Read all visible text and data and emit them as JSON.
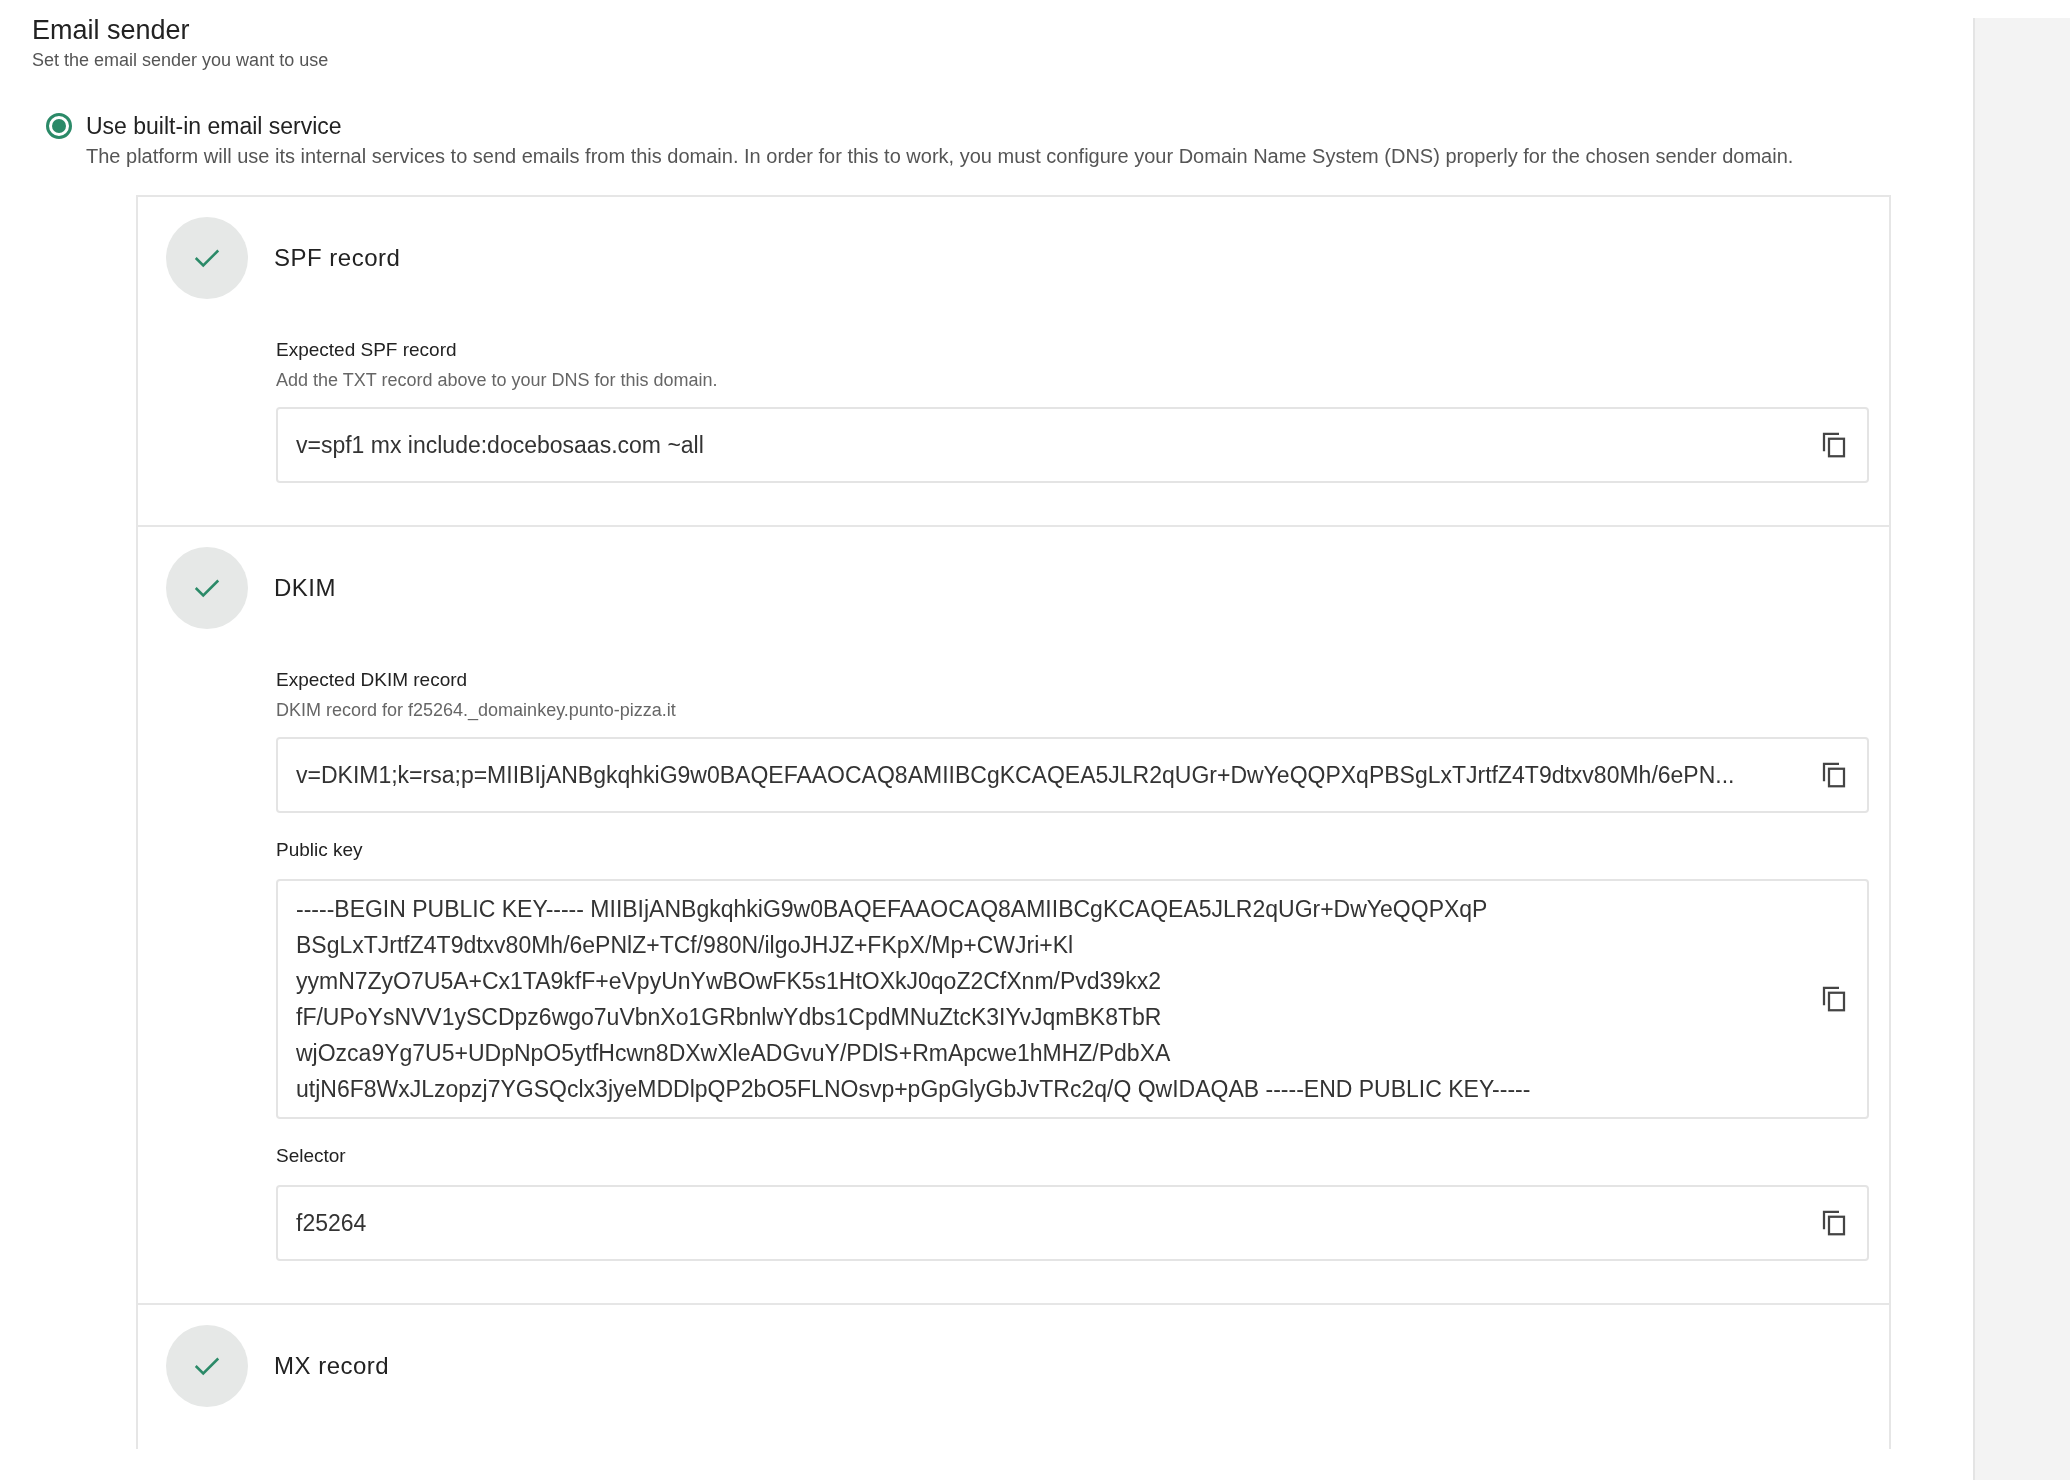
{
  "header": {
    "title": "Email sender",
    "subtitle": "Set the email sender you want to use"
  },
  "sender_option": {
    "label": "Use built-in email service",
    "description": "The platform will use its internal services to send emails from this domain. In order for this to work, you must configure your Domain Name System (DNS) properly for the chosen sender domain.",
    "selected": true
  },
  "sections": [
    {
      "title": "SPF record",
      "verified": true,
      "fields": [
        {
          "label": "Expected SPF record",
          "hint": "Add the TXT record above to your DNS for this domain.",
          "lines": [
            "v=spf1 mx include:docebosaas.com ~all"
          ]
        }
      ]
    },
    {
      "title": "DKIM",
      "verified": true,
      "fields": [
        {
          "label": "Expected DKIM record",
          "hint": "DKIM record for f25264._domainkey.punto-pizza.it",
          "lines": [
            "v=DKIM1;k=rsa;p=MIIBIjANBgkqhkiG9w0BAQEFAAOCAQ8AMIIBCgKCAQEA5JLR2qUGr+DwYeQQPXqPBSgLxTJrtfZ4T9dtxv80Mh/6ePN..."
          ]
        },
        {
          "label": "Public key",
          "lines": [
            "-----BEGIN PUBLIC KEY----- MIIBIjANBgkqhkiG9w0BAQEFAAOCAQ8AMIIBCgKCAQEA5JLR2qUGr+DwYeQQPXqP",
            "BSgLxTJrtfZ4T9dtxv80Mh/6ePNlZ+TCf/980N/ilgoJHJZ+FKpX/Mp+CWJri+Kl",
            "yymN7ZyO7U5A+Cx1TA9kfF+eVpyUnYwBOwFK5s1HtOXkJ0qoZ2CfXnm/Pvd39kx2",
            "fF/UPoYsNVV1ySCDpz6wgo7uVbnXo1GRbnlwYdbs1CpdMNuZtcK3IYvJqmBK8TbR",
            "wjOzca9Yg7U5+UDpNpO5ytfHcwn8DXwXleADGvuY/PDlS+RmApcwe1hMHZ/PdbXA",
            "utjN6F8WxJLzopzj7YGSQclx3jyeMDDlpQP2bO5FLNOsvp+pGpGlyGbJvTRc2q/Q QwIDAQAB -----END PUBLIC KEY-----"
          ]
        },
        {
          "label": "Selector",
          "lines": [
            "f25264"
          ]
        }
      ]
    },
    {
      "title": "MX record",
      "verified": true
    }
  ]
}
